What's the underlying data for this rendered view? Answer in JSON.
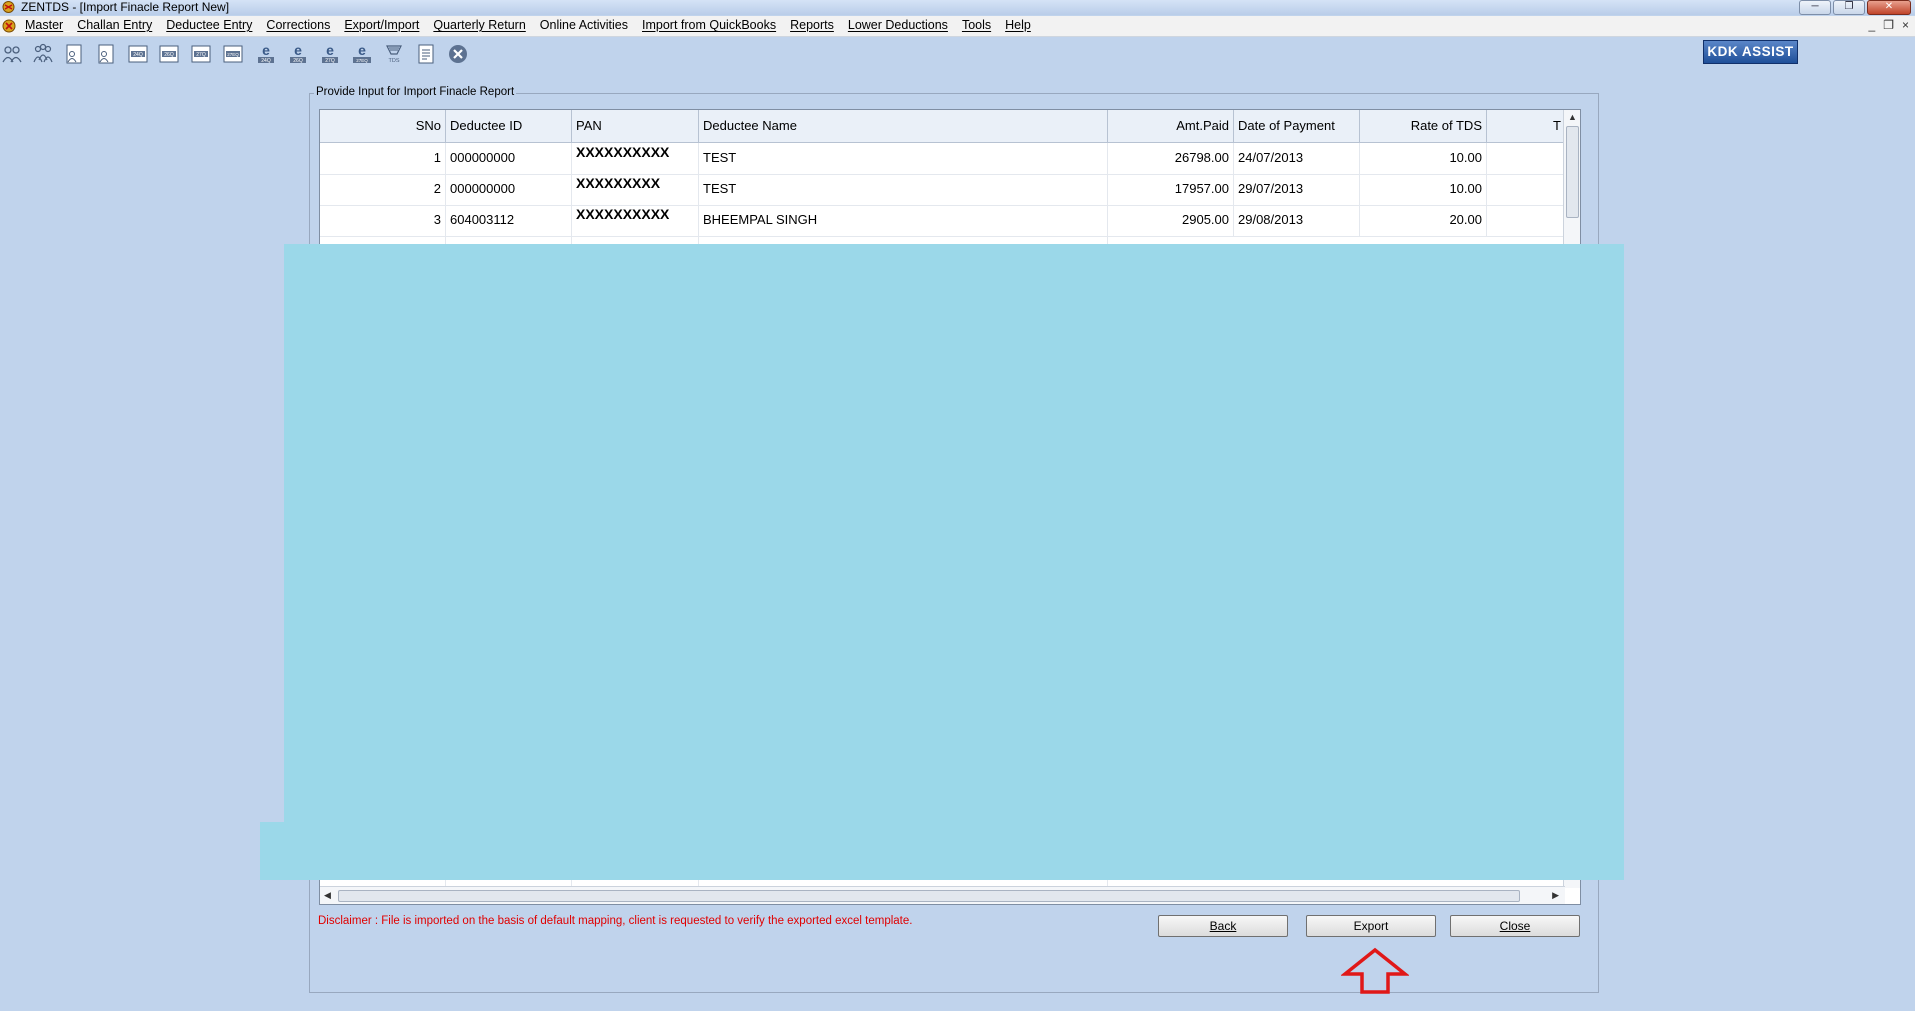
{
  "window": {
    "title": "ZENTDS - [Import Finacle Report New]",
    "controls": [
      "─",
      "❐",
      "✕"
    ]
  },
  "menu": {
    "items": [
      "Master",
      "Challan Entry",
      "Deductee Entry",
      "Corrections",
      "Export/Import",
      "Quarterly Return",
      "Online Activities",
      "Import from QuickBooks",
      "Reports",
      "Lower Deductions",
      "Tools",
      "Help"
    ],
    "mdi_controls": [
      "_",
      "❐",
      "×"
    ]
  },
  "toolbar": {
    "icons": [
      "deductor-icon",
      "users-group-icon",
      "deductee-icon",
      "deductee-alt-icon",
      "form-24q-icon",
      "form-26q-icon",
      "form-27q-icon",
      "form-27eq-icon",
      "e-24q-icon",
      "e-26q-icon",
      "e-27q-icon",
      "e-27eq-icon",
      "tds-icon",
      "report-icon",
      "close-circle-icon"
    ],
    "small_labels": [
      "24Q",
      "26Q",
      "27Q",
      "27EQ",
      "24Q",
      "26Q",
      "27Q",
      "27EQ",
      "TDS"
    ],
    "kdk_assist": "KDK ASSIST"
  },
  "panel": {
    "title": "Provide Input for Import Finacle Report"
  },
  "grid": {
    "columns": [
      "SNo",
      "Deductee ID",
      "PAN",
      "Deductee Name",
      "Amt.Paid",
      "Date of Payment",
      "Rate of TDS",
      "T"
    ],
    "rows": [
      {
        "sno": "1",
        "deductee_id": "000000000",
        "pan": "XXXXXXXXXX",
        "name": "TEST",
        "amt_paid": "26798.00",
        "date": "24/07/2013",
        "rate": "10.00"
      },
      {
        "sno": "2",
        "deductee_id": "000000000",
        "pan": "XXXXXXXXX",
        "name": "TEST",
        "amt_paid": "17957.00",
        "date": "29/07/2013",
        "rate": "10.00"
      },
      {
        "sno": "3",
        "deductee_id": "604003112",
        "pan": "XXXXXXXXXX",
        "name": "BHEEMPAL SINGH",
        "amt_paid": "2905.00",
        "date": "29/08/2013",
        "rate": "20.00"
      }
    ]
  },
  "footer": {
    "disclaimer": "Disclaimer : File is imported on the basis of default mapping, client is requested to verify the exported excel template.",
    "back_label": "Back",
    "export_label": "Export",
    "close_label": "Close"
  },
  "colors": {
    "background": "#c0d3ec",
    "redaction": "#9bd8e9",
    "disclaimer": "#e00000",
    "annotation_arrow": "#e01818"
  }
}
